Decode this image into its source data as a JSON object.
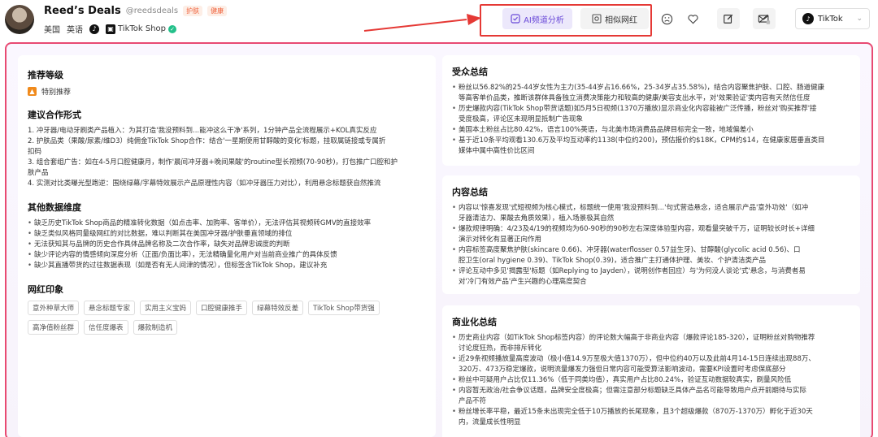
{
  "profile": {
    "name": "Reed’s Deals",
    "handle": "@reedsdeals",
    "tags": [
      "护肤",
      "健康"
    ],
    "country": "美国",
    "language": "英语",
    "shop_label": "TikTok Shop"
  },
  "toolbar": {
    "ai_label": "AI频道分析",
    "similar_label": "相似网红",
    "platform": "TikTok"
  },
  "left": {
    "rec_title": "推荐等级",
    "rec_value": "特别推荐",
    "coop_title": "建议合作形式",
    "coop_items": [
      "1. 冲牙器/电动牙刷类产品植入：为其打造'我没预料到...能冲这么干净'系列，1分钟产品全流程展示+KOL真实反应",
      "2. 护肤品类（果酸/尿素/维D3）纯佣金TikTok Shop合作：结合'一星期使用甘醇酸的变化'标题，挂取属链接或专属折",
      "   扣码",
      "3. 组合套组广告：如在4-5月口腔健康月，制作'晨间冲牙器+晚间果酸'的routine型长视频(70-90秒)，打包推广口腔和护",
      "   肤产品",
      "4. 实测对比类曝光型跑逆：围绕绿幕/字幕特效展示产品原理性内容（如冲牙器压力对比），利用悬念标题获自然推流"
    ],
    "other_title": "其他数据维度",
    "other_items": [
      "缺乏历史TikTok Shop商品的精准转化数据（如点击率、加购率、客单价），无法评估其视频转GMV的直接效率",
      "缺乏类似风格同量级网红的对比数据，难以判断其在美国冲牙器/护肤垂直领域的排位",
      "无法获知其与品牌的历史合作具体品牌名称及二次合作率，缺失对品牌忠诚度的判断",
      "缺少评论内容的情感倾向深度分析（正面/负面比率），无法精确量化用户对当前商业推广的具体反馈",
      "缺少其直播带货的过往数据表现（如是否有无人间津的情况），但标签含TikTok Shop，建议补充"
    ],
    "imp_title": "网红印象",
    "imp_tags": [
      "意外种草大师",
      "悬念标题专家",
      "实用主义宝妈",
      "口腔健康推手",
      "绿幕特效反差",
      "TikTok Shop带货强",
      "高净值粉丝群",
      "信任度爆表",
      "爆款制造机"
    ]
  },
  "audience": {
    "title": "受众总结",
    "items": [
      "粉丝以56.82%的25-44岁女性为主力(35-44岁占16.66%，25-34岁占35.58%)，结合内容聚焦护肤、口腔、肠道健康",
      "等高客单价品类，推断该群体具备独立消费决策能力和较高的健康/美容支出水平，对'效果验证'类内容有天然信任度",
      "历史爆款内容(TikTok Shop带货话题)如5月5日视频(1370万播放)显示商业化内容能被广泛传播，粉丝对'购买推荐'接",
      "受度极高，评论区未现明显抵制广告现象",
      "美国本土粉丝占比80.42%，语言100%英语，与北美市场消费品品牌目标完全一致，地域偏差小",
      "基于近10条平均观看130.6万及平均互动率约1138(中位约200)，预估报价约$18K，CPM约$14，在健康家居垂直类目",
      "媒体中属中高性价比区间"
    ]
  },
  "content": {
    "title": "内容总结",
    "items": [
      "内容以'惊喜发现'式短视频为核心模式，标题统一使用'我没预料到...'句式营造悬念，适合展示产品'意外功效'（如冲",
      "牙器清洁力、果酸去角质效果），植入场景极其自然",
      "爆款规律明确：4/23及4/19的视频均为60-90秒的90秒左右深度体验型内容，观看量突破千万，证明较长时长+详细",
      "演示对转化有显著正向作用",
      "内容标签高度聚焦护肤(skincare 0.66)、冲牙器(waterflosser 0.57益生牙)、甘醇酸(glycolic acid 0.56)、口",
      "腔卫生(oral hygiene 0.39)、TikTok Shop(0.39)，适合推广主打通体护理、美妆、个护清洁类产品",
      "评论互动中多见'揭露型'标题（如Replying to Jayden），说明创作者回应）与'为何没人谈论'式'悬念，与消费者易",
      "对'冷门有效产品'产生兴趣的心理高度契合"
    ]
  },
  "commercial": {
    "title": "商业化总结",
    "items": [
      "历史商业内容（如TikTok Shop标签内容）的评论数大幅高于非商业内容（爆款评论185-320），证明粉丝对购物推荐",
      "讨论度狂热，而非排斥转化",
      "近29条视频播放量高度波动（极小值14.9万至极大值1370万），但中位约40万以及此前4月14-15日连续出现88万、",
      "320万、473万稳定爆款，说明流量爆发力强但日常内容可能受算法影响波动，需要KPI设置时考虑保底部分",
      "粉丝中可疑用户占比仅11.36%（低于同类均值），真实用户占比80.24%，验证互动数据较真实，刷量风险低",
      "内容暂无政治/社会争议话题，品牌安全度极高；但需注意部分标题缺乏具体产品名可能导致用户点开前期待与实际",
      "产品不符",
      "粉丝增长率平稳，最近15条未出现完全低于10万播放的长尾现象，且3个超级爆款（870万-1370万）孵化于近30天",
      "内，流量成长性明显"
    ]
  }
}
